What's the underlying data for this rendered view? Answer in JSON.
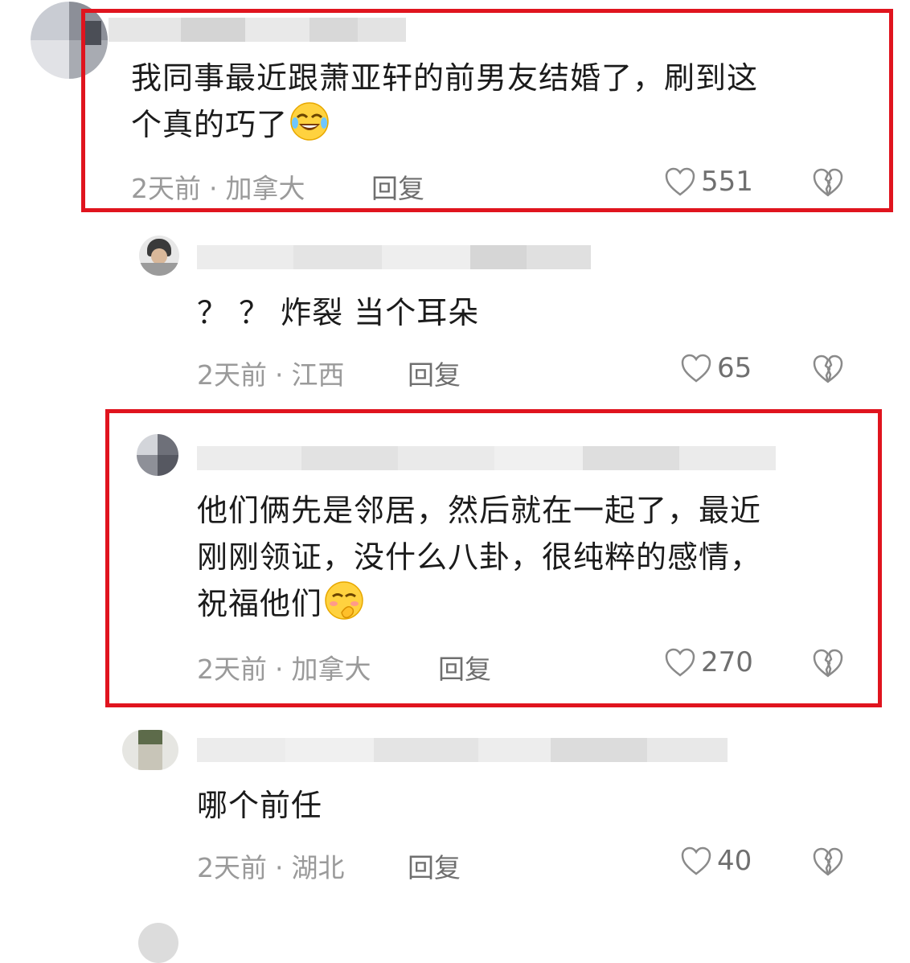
{
  "comments": [
    {
      "text_lines": [
        "我同事最近跟萧亚轩的前男友结婚了，刷到这",
        "个真的巧了"
      ],
      "emoji": "crying-laughing-emoji",
      "time": "2天前",
      "location": "加拿大",
      "reply_label": "回复",
      "likes": "551",
      "highlighted": true
    },
    {
      "text_lines": [
        "？ ？ 炸裂 当个耳朵"
      ],
      "time": "2天前",
      "location": "江西",
      "reply_label": "回复",
      "likes": "65",
      "highlighted": false
    },
    {
      "text_lines": [
        "他们俩先是邻居，然后就在一起了，最近",
        "刚刚领证，没什么八卦，很纯粹的感情，",
        "祝福他们"
      ],
      "emoji": "shy-smile-emoji",
      "time": "2天前",
      "location": "加拿大",
      "reply_label": "回复",
      "likes": "270",
      "highlighted": true
    },
    {
      "text_lines": [
        "哪个前任"
      ],
      "time": "2天前",
      "location": "湖北",
      "reply_label": "回复",
      "likes": "40",
      "highlighted": false
    }
  ],
  "colors": {
    "highlight_border": "#e0141e",
    "meta_text": "#9a9a9a",
    "body_text": "#1b1b1b"
  },
  "icons": {
    "like": "heart-outline-icon",
    "dislike": "broken-heart-icon"
  }
}
